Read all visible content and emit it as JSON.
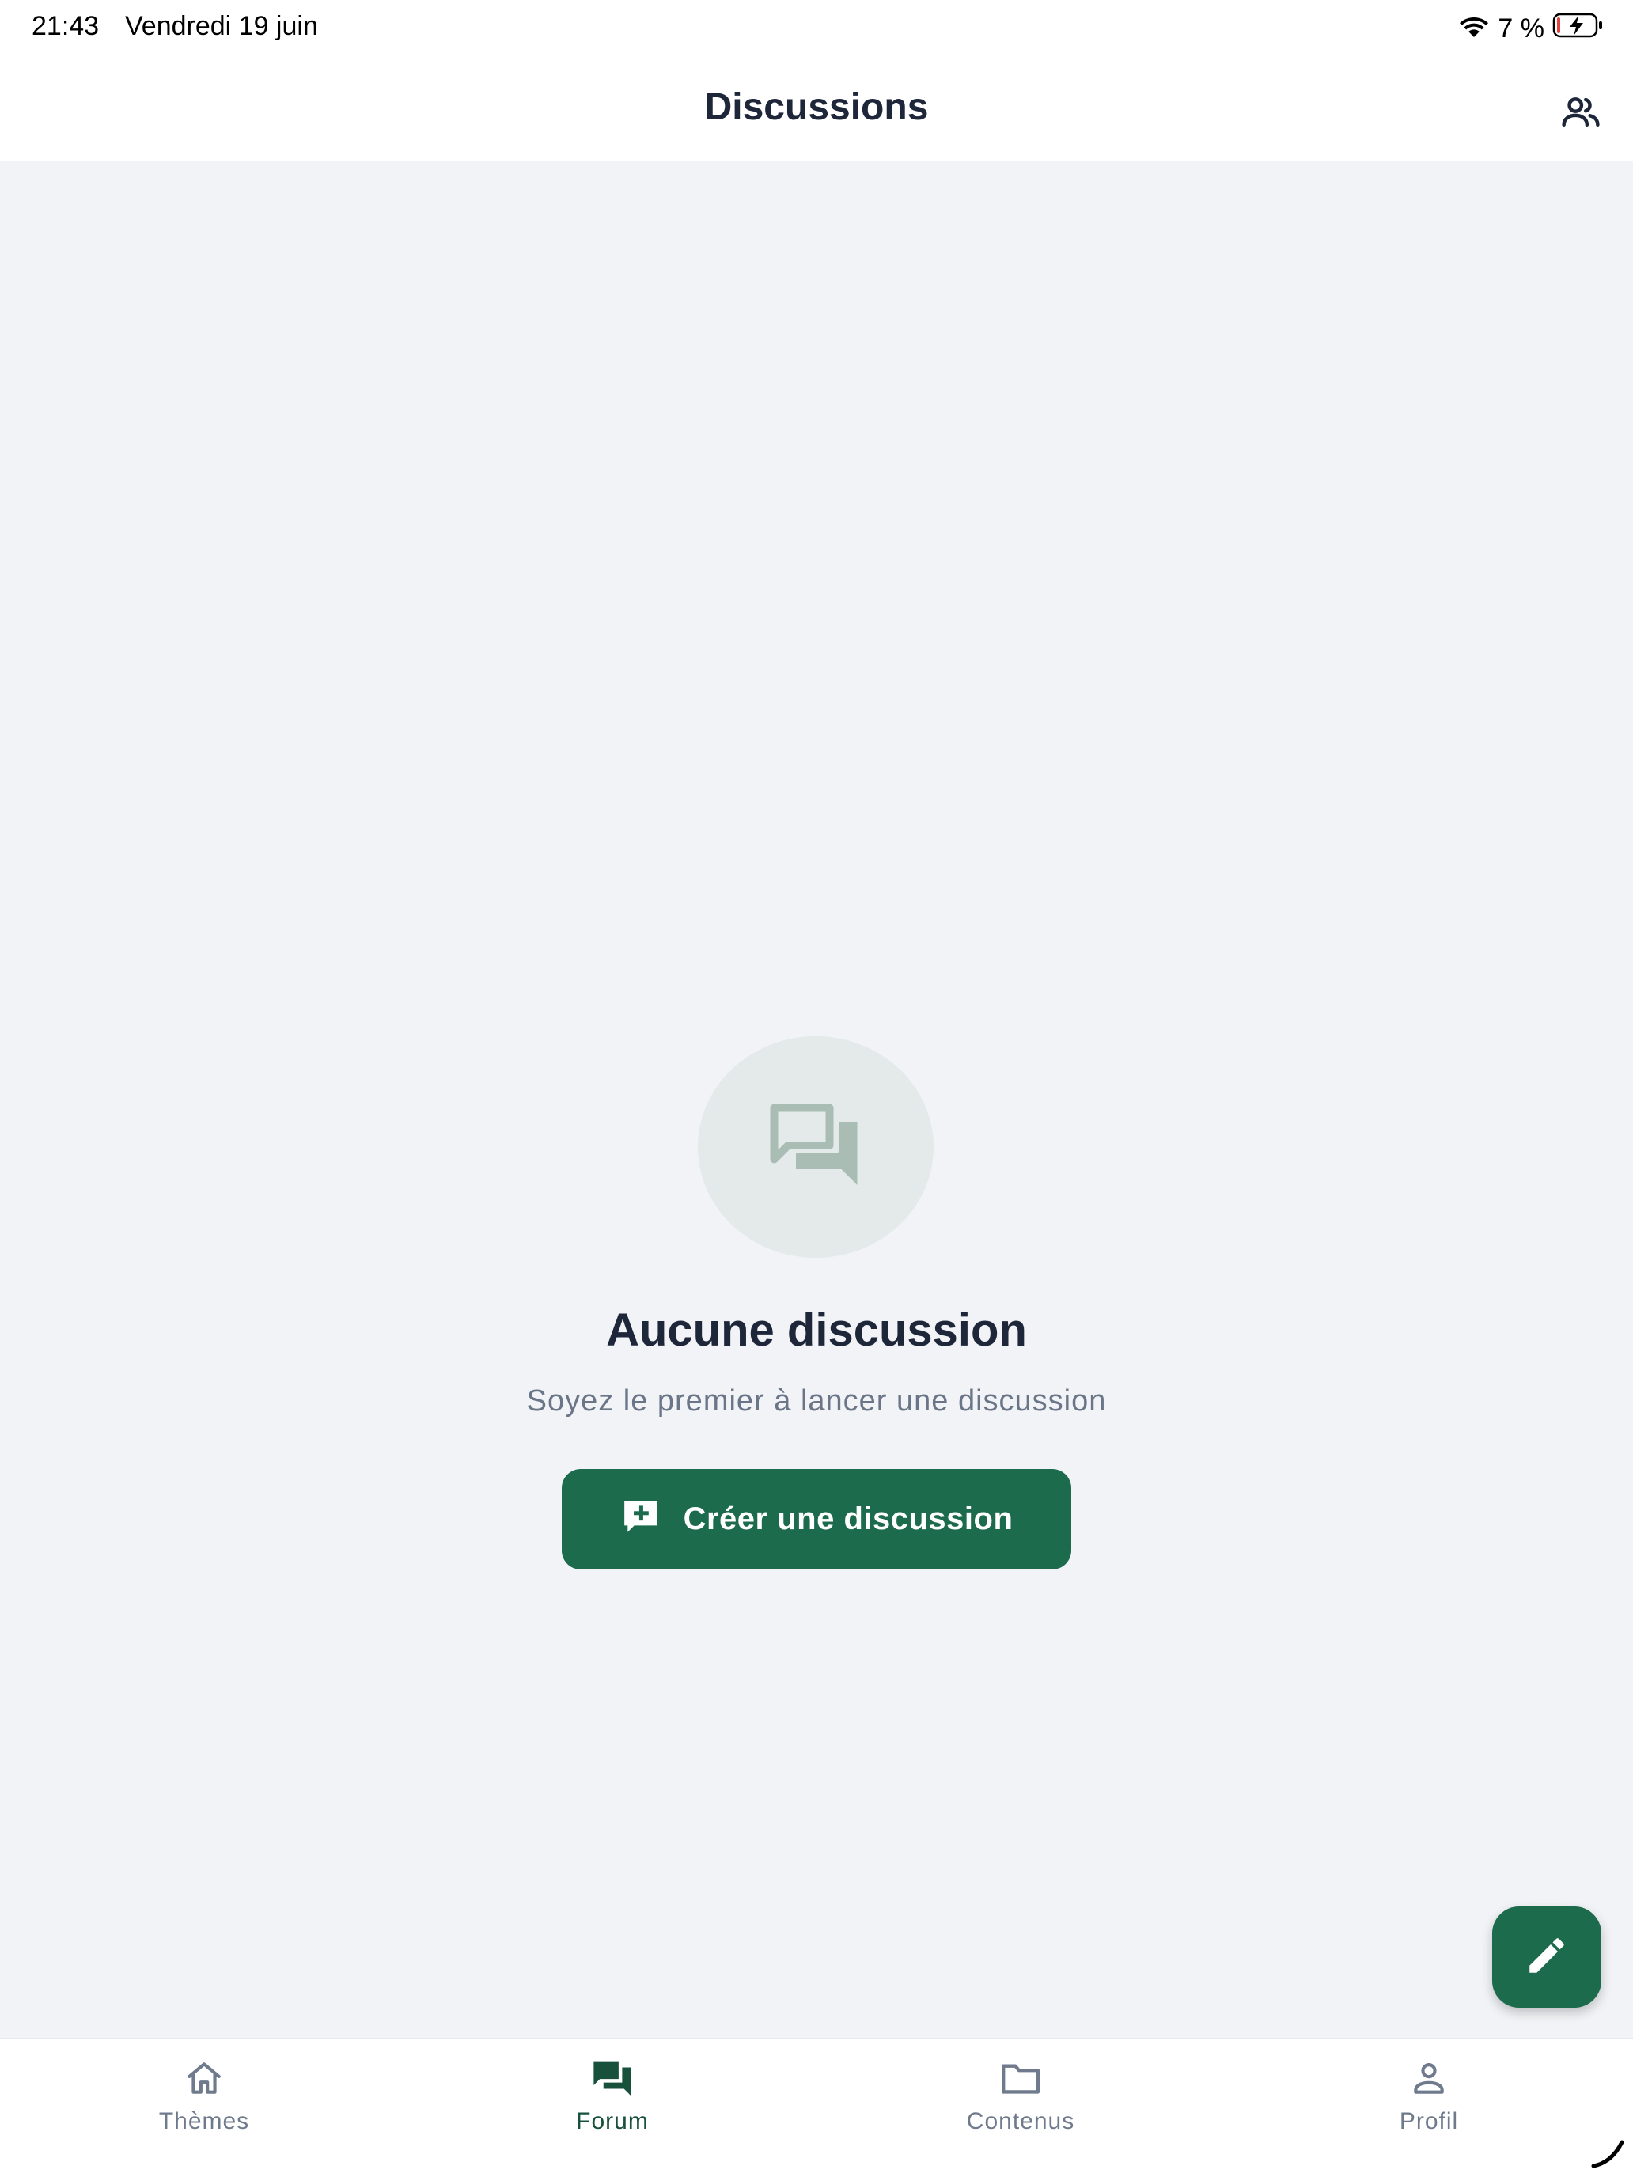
{
  "status_bar": {
    "time": "21:43",
    "date": "Vendredi 19 juin",
    "battery_percent": "7 %",
    "icons": [
      "wifi-icon",
      "battery-charging-icon"
    ]
  },
  "header": {
    "title": "Discussions",
    "action_icon": "group-icon"
  },
  "empty_state": {
    "icon": "forum-icon",
    "title": "Aucune discussion",
    "subtitle": "Soyez le premier à lancer une discussion",
    "button_label": "Créer une discussion",
    "button_icon": "add-comment-icon"
  },
  "fab": {
    "icon": "edit-pencil-icon"
  },
  "bottom_nav": {
    "active": "Forum",
    "items": [
      {
        "label": "Thèmes",
        "icon": "home-icon"
      },
      {
        "label": "Forum",
        "icon": "forum-icon"
      },
      {
        "label": "Contenus",
        "icon": "folder-icon"
      },
      {
        "label": "Profil",
        "icon": "person-icon"
      }
    ]
  },
  "colors": {
    "primary": "#1C6B4D",
    "primary_dark": "#17503B",
    "background": "#F1F3F6",
    "surface": "#FFFFFF",
    "text": "#1E2639",
    "muted_text": "#6A7588",
    "illustration_bg": "#E4E9EA",
    "illustration_icon": "#A9BDB4"
  }
}
